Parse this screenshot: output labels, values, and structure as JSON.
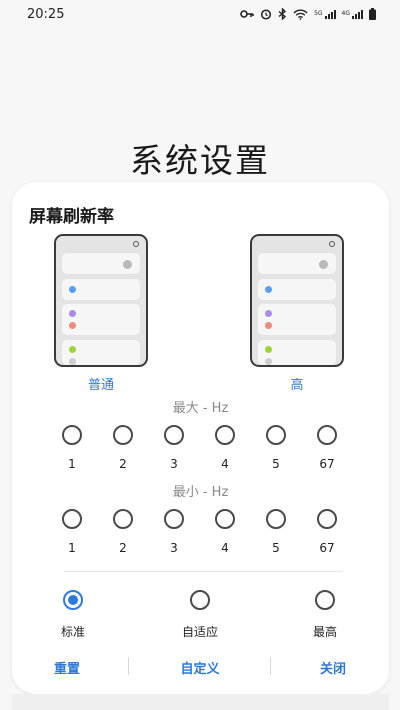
{
  "status_bar": {
    "time": "20:25",
    "icons": [
      "key-icon",
      "alarm-icon",
      "bluetooth-icon",
      "wifi-icon",
      "signal-5g-icon",
      "signal-4g-icon",
      "battery-icon"
    ],
    "net1": "5G",
    "net2": "4G"
  },
  "page": {
    "title": "系统设置"
  },
  "dialog": {
    "title": "屏幕刷新率",
    "modes": {
      "left": "普通",
      "right": "高"
    },
    "max_label": "最大 - Hz",
    "min_label": "最小 - Hz",
    "rate_options": [
      "1",
      "2",
      "3",
      "4",
      "5",
      "67"
    ],
    "presets": [
      {
        "label": "标准",
        "selected": true
      },
      {
        "label": "自适应",
        "selected": false
      },
      {
        "label": "最高",
        "selected": false
      }
    ],
    "buttons": {
      "reset": "重置",
      "custom": "自定义",
      "close": "关闭"
    }
  },
  "colors": {
    "accent": "#2e7be0",
    "dot_blue": "#5aa0f0",
    "dot_purple": "#a78bf0",
    "dot_red": "#f08a7a",
    "dot_green": "#9ed43a"
  }
}
